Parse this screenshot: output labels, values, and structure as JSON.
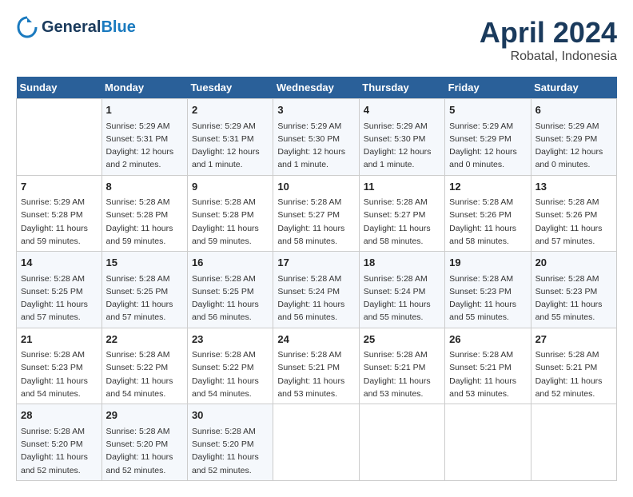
{
  "header": {
    "logo_line1": "General",
    "logo_line2": "Blue",
    "title": "April 2024",
    "subtitle": "Robatal, Indonesia"
  },
  "columns": [
    "Sunday",
    "Monday",
    "Tuesday",
    "Wednesday",
    "Thursday",
    "Friday",
    "Saturday"
  ],
  "weeks": [
    [
      {
        "day": "",
        "info": ""
      },
      {
        "day": "1",
        "info": "Sunrise: 5:29 AM\nSunset: 5:31 PM\nDaylight: 12 hours\nand 2 minutes."
      },
      {
        "day": "2",
        "info": "Sunrise: 5:29 AM\nSunset: 5:31 PM\nDaylight: 12 hours\nand 1 minute."
      },
      {
        "day": "3",
        "info": "Sunrise: 5:29 AM\nSunset: 5:30 PM\nDaylight: 12 hours\nand 1 minute."
      },
      {
        "day": "4",
        "info": "Sunrise: 5:29 AM\nSunset: 5:30 PM\nDaylight: 12 hours\nand 1 minute."
      },
      {
        "day": "5",
        "info": "Sunrise: 5:29 AM\nSunset: 5:29 PM\nDaylight: 12 hours\nand 0 minutes."
      },
      {
        "day": "6",
        "info": "Sunrise: 5:29 AM\nSunset: 5:29 PM\nDaylight: 12 hours\nand 0 minutes."
      }
    ],
    [
      {
        "day": "7",
        "info": "Sunrise: 5:29 AM\nSunset: 5:28 PM\nDaylight: 11 hours\nand 59 minutes."
      },
      {
        "day": "8",
        "info": "Sunrise: 5:28 AM\nSunset: 5:28 PM\nDaylight: 11 hours\nand 59 minutes."
      },
      {
        "day": "9",
        "info": "Sunrise: 5:28 AM\nSunset: 5:28 PM\nDaylight: 11 hours\nand 59 minutes."
      },
      {
        "day": "10",
        "info": "Sunrise: 5:28 AM\nSunset: 5:27 PM\nDaylight: 11 hours\nand 58 minutes."
      },
      {
        "day": "11",
        "info": "Sunrise: 5:28 AM\nSunset: 5:27 PM\nDaylight: 11 hours\nand 58 minutes."
      },
      {
        "day": "12",
        "info": "Sunrise: 5:28 AM\nSunset: 5:26 PM\nDaylight: 11 hours\nand 58 minutes."
      },
      {
        "day": "13",
        "info": "Sunrise: 5:28 AM\nSunset: 5:26 PM\nDaylight: 11 hours\nand 57 minutes."
      }
    ],
    [
      {
        "day": "14",
        "info": "Sunrise: 5:28 AM\nSunset: 5:25 PM\nDaylight: 11 hours\nand 57 minutes."
      },
      {
        "day": "15",
        "info": "Sunrise: 5:28 AM\nSunset: 5:25 PM\nDaylight: 11 hours\nand 57 minutes."
      },
      {
        "day": "16",
        "info": "Sunrise: 5:28 AM\nSunset: 5:25 PM\nDaylight: 11 hours\nand 56 minutes."
      },
      {
        "day": "17",
        "info": "Sunrise: 5:28 AM\nSunset: 5:24 PM\nDaylight: 11 hours\nand 56 minutes."
      },
      {
        "day": "18",
        "info": "Sunrise: 5:28 AM\nSunset: 5:24 PM\nDaylight: 11 hours\nand 55 minutes."
      },
      {
        "day": "19",
        "info": "Sunrise: 5:28 AM\nSunset: 5:23 PM\nDaylight: 11 hours\nand 55 minutes."
      },
      {
        "day": "20",
        "info": "Sunrise: 5:28 AM\nSunset: 5:23 PM\nDaylight: 11 hours\nand 55 minutes."
      }
    ],
    [
      {
        "day": "21",
        "info": "Sunrise: 5:28 AM\nSunset: 5:23 PM\nDaylight: 11 hours\nand 54 minutes."
      },
      {
        "day": "22",
        "info": "Sunrise: 5:28 AM\nSunset: 5:22 PM\nDaylight: 11 hours\nand 54 minutes."
      },
      {
        "day": "23",
        "info": "Sunrise: 5:28 AM\nSunset: 5:22 PM\nDaylight: 11 hours\nand 54 minutes."
      },
      {
        "day": "24",
        "info": "Sunrise: 5:28 AM\nSunset: 5:21 PM\nDaylight: 11 hours\nand 53 minutes."
      },
      {
        "day": "25",
        "info": "Sunrise: 5:28 AM\nSunset: 5:21 PM\nDaylight: 11 hours\nand 53 minutes."
      },
      {
        "day": "26",
        "info": "Sunrise: 5:28 AM\nSunset: 5:21 PM\nDaylight: 11 hours\nand 53 minutes."
      },
      {
        "day": "27",
        "info": "Sunrise: 5:28 AM\nSunset: 5:21 PM\nDaylight: 11 hours\nand 52 minutes."
      }
    ],
    [
      {
        "day": "28",
        "info": "Sunrise: 5:28 AM\nSunset: 5:20 PM\nDaylight: 11 hours\nand 52 minutes."
      },
      {
        "day": "29",
        "info": "Sunrise: 5:28 AM\nSunset: 5:20 PM\nDaylight: 11 hours\nand 52 minutes."
      },
      {
        "day": "30",
        "info": "Sunrise: 5:28 AM\nSunset: 5:20 PM\nDaylight: 11 hours\nand 52 minutes."
      },
      {
        "day": "",
        "info": ""
      },
      {
        "day": "",
        "info": ""
      },
      {
        "day": "",
        "info": ""
      },
      {
        "day": "",
        "info": ""
      }
    ]
  ]
}
